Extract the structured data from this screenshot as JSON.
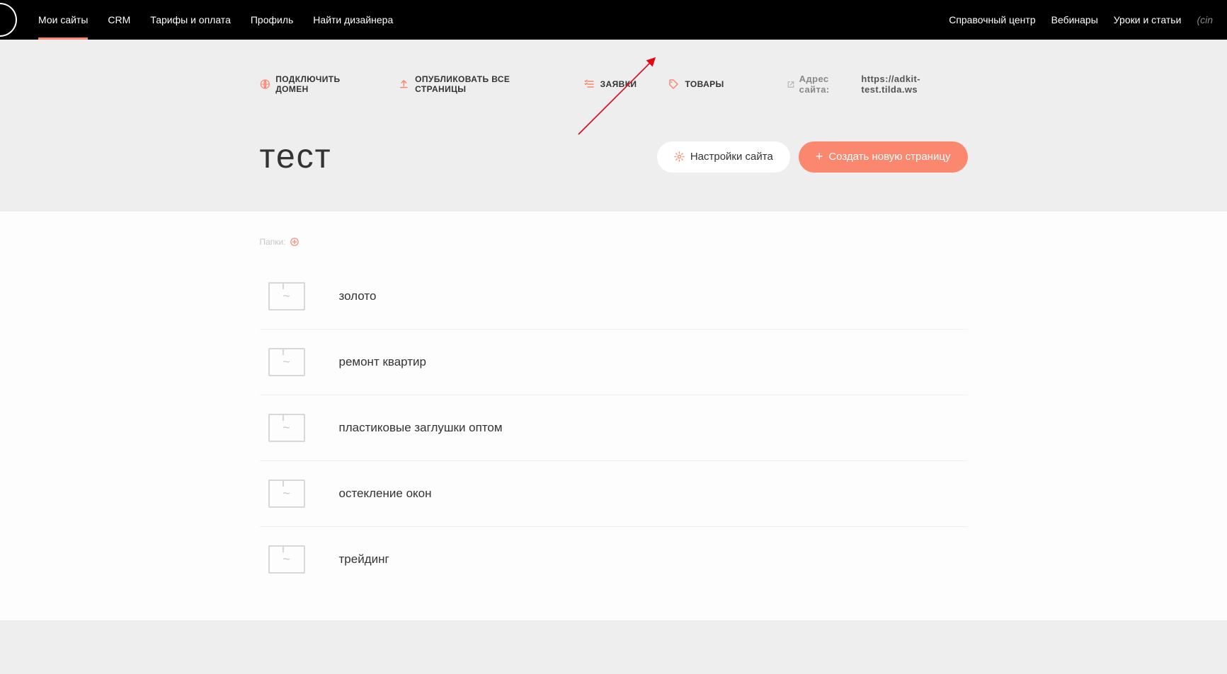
{
  "nav": {
    "left": [
      {
        "label": "Мои сайты",
        "id": "my-sites",
        "active": true
      },
      {
        "label": "CRM",
        "id": "crm",
        "active": false
      },
      {
        "label": "Тарифы и оплата",
        "id": "billing",
        "active": false
      },
      {
        "label": "Профиль",
        "id": "profile",
        "active": false
      },
      {
        "label": "Найти дизайнера",
        "id": "find-designer",
        "active": false
      }
    ],
    "right": [
      {
        "label": "Справочный центр",
        "id": "help-center"
      },
      {
        "label": "Вебинары",
        "id": "webinars"
      },
      {
        "label": "Уроки и статьи",
        "id": "lessons"
      }
    ],
    "cin": "(cin"
  },
  "action_bar": {
    "connect_domain": "ПОДКЛЮЧИТЬ ДОМЕН",
    "publish_all": "ОПУБЛИКОВАТЬ ВСЕ СТРАНИЦЫ",
    "leads": "ЗАЯВКИ",
    "products": "ТОВАРЫ",
    "address_label": "Адрес сайта:",
    "address_url": "https://adkit-test.tilda.ws"
  },
  "title_row": {
    "project_title": "тест",
    "settings_label": "Настройки сайта",
    "create_page_label": "Создать новую страницу"
  },
  "folders": {
    "label": "Папки:"
  },
  "pages": [
    {
      "title": "золото"
    },
    {
      "title": "ремонт квартир"
    },
    {
      "title": "пластиковые заглушки оптом"
    },
    {
      "title": "остекление окон"
    },
    {
      "title": "трейдинг"
    }
  ]
}
